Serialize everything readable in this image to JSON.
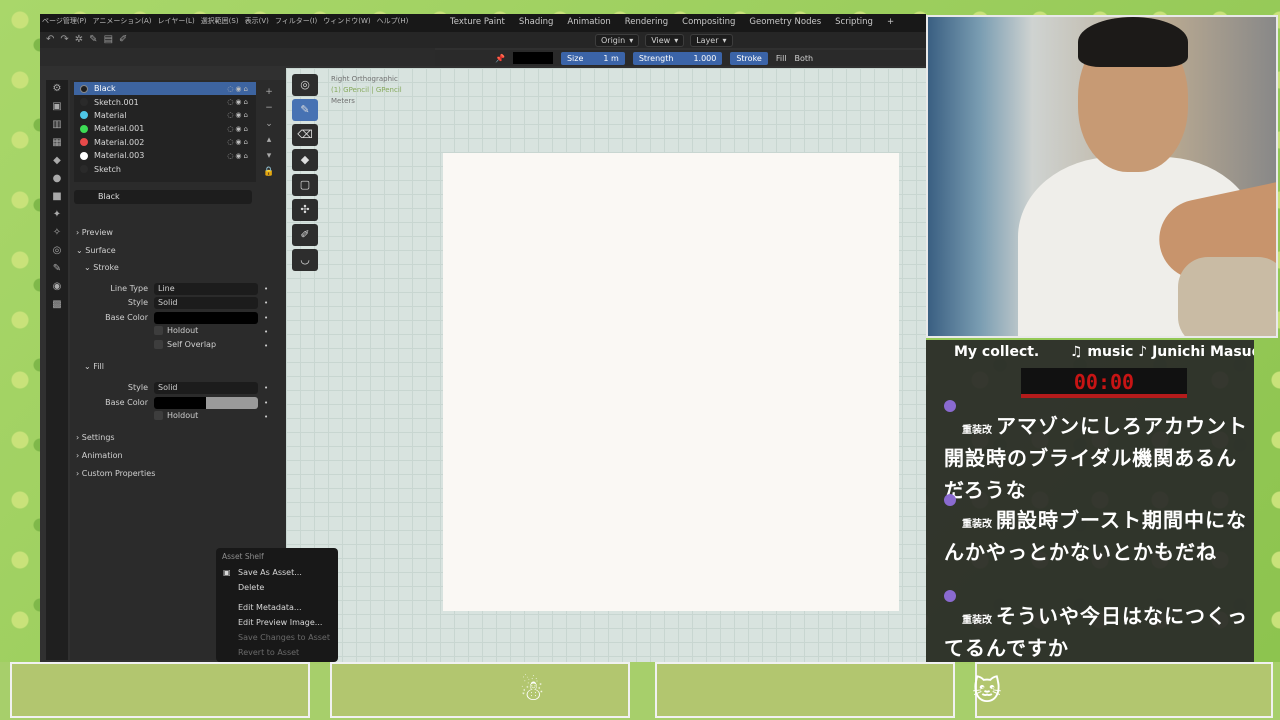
{
  "menu": [
    "ページ管理(P)",
    "アニメーション(A)",
    "レイヤー(L)",
    "選択範囲(S)",
    "表示(V)",
    "フィルター(I)",
    "ウィンドウ(W)",
    "ヘルプ(H)"
  ],
  "workspaces": [
    "Texture Paint",
    "Shading",
    "Animation",
    "Rendering",
    "Compositing",
    "Geometry Nodes",
    "Scripting",
    "+"
  ],
  "header": {
    "origin": "Origin",
    "view": "View",
    "layer": "Layer",
    "size_label": "Size",
    "size_value": "1 m",
    "strength_label": "Strength",
    "strength_value": "1.000",
    "stroke": "Stroke",
    "fill": "Fill",
    "both": "Both"
  },
  "materials": [
    {
      "name": "Black",
      "color": "#1e1e1e",
      "selected": true
    },
    {
      "name": "Sketch.001",
      "color": "#2a2a2a",
      "selected": false
    },
    {
      "name": "Material",
      "color": "#4ec6e6",
      "selected": false
    },
    {
      "name": "Material.001",
      "color": "#3ddc55",
      "selected": false
    },
    {
      "name": "Material.002",
      "color": "#e84a4a",
      "selected": false
    },
    {
      "name": "Material.003",
      "color": "#ffffff",
      "selected": false
    },
    {
      "name": "Sketch",
      "color": "#2a2a2a",
      "selected": false
    }
  ],
  "material_name": "Black",
  "panels": {
    "preview": "Preview",
    "surface": "Surface",
    "stroke": "Stroke",
    "line_type_label": "Line Type",
    "line_type_value": "Line",
    "style_label": "Style",
    "style_value": "Solid",
    "base_color_label": "Base Color",
    "holdout": "Holdout",
    "self_overlap": "Self Overlap",
    "fill": "Fill",
    "fill_style_value": "Solid",
    "settings": "Settings",
    "animation": "Animation",
    "custom_properties": "Custom Properties"
  },
  "viewport": {
    "line1": "Right Orthographic",
    "line2": "(1) GPencil | GPencil",
    "line3": "Meters"
  },
  "context_menu": {
    "title": "Asset Shelf",
    "items": [
      {
        "label": "Save As Asset...",
        "disabled": false
      },
      {
        "label": "Delete",
        "disabled": false
      },
      {
        "label": "Edit Metadata...",
        "disabled": false
      },
      {
        "label": "Edit Preview Image...",
        "disabled": false
      },
      {
        "label": "Save Changes to Asset",
        "disabled": true
      },
      {
        "label": "Revert to Asset",
        "disabled": true
      }
    ]
  },
  "stream": {
    "now_playing": "My collect.",
    "music": "♫ music ♪ Junichi Masuda",
    "timer": "00:00",
    "messages": [
      {
        "user": "重装改",
        "text": "アマゾンにしろアカウント開設時のブライダル機関あるんだろうな"
      },
      {
        "user": "重装改",
        "text": "開設時ブースト期間中になんかやっとかないとかもだね"
      },
      {
        "user": "重装改",
        "text": "そういや今日はなにつくってるんですか"
      }
    ]
  }
}
